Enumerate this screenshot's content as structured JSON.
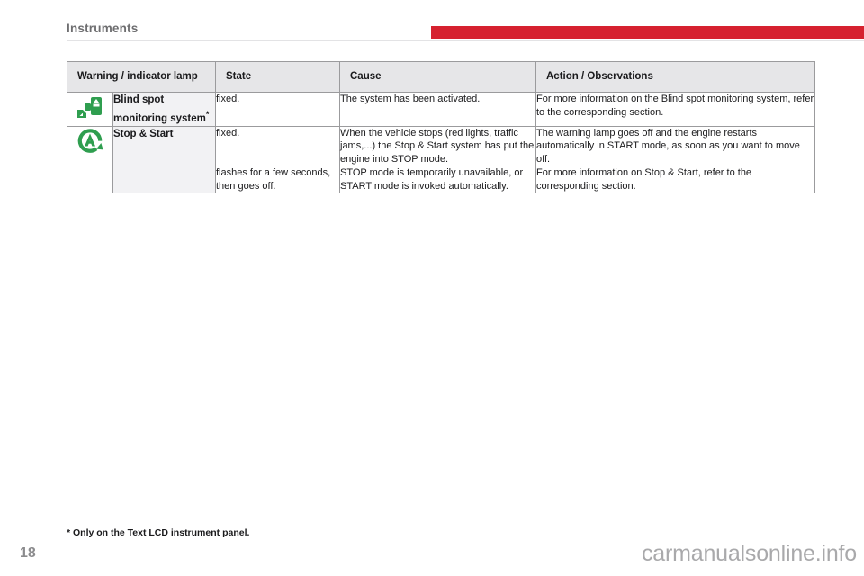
{
  "header": {
    "section_title": "Instruments",
    "accent_color": "#d6212f"
  },
  "table": {
    "columns": [
      {
        "key": "lamp",
        "label": "Warning / indicator lamp"
      },
      {
        "key": "state",
        "label": "State"
      },
      {
        "key": "cause",
        "label": "Cause"
      },
      {
        "key": "action",
        "label": "Action / Observations"
      }
    ],
    "rows": [
      {
        "icon": "blind-spot-monitoring-icon",
        "icon_color": "#2f9e4f",
        "name": "Blind spot monitoring system",
        "name_footnote_mark": "*",
        "state": "fixed.",
        "cause": "The system has been activated.",
        "action": "For more information on the Blind spot monitoring system, refer to the corresponding section."
      },
      {
        "icon": "stop-and-start-icon",
        "icon_color": "#2f9e4f",
        "name": "Stop & Start",
        "name_footnote_mark": "",
        "state": "fixed.",
        "cause": "When the vehicle stops (red lights, traffic jams,...) the Stop & Start system has put the engine into STOP mode.",
        "action": "The warning lamp goes off and the engine restarts automatically in START mode, as soon as you want to move off."
      },
      {
        "icon": "",
        "icon_color": "",
        "name": "",
        "name_footnote_mark": "",
        "state": "flashes for a few seconds, then goes off.",
        "cause": "STOP mode is temporarily unavailable, or START mode is invoked automatically.",
        "action": "For more information on Stop & Start, refer to the corresponding section."
      }
    ]
  },
  "footer": {
    "footnote": "* Only on the Text LCD instrument panel.",
    "page_number": "18",
    "watermark": "carmanualsonline.info"
  }
}
